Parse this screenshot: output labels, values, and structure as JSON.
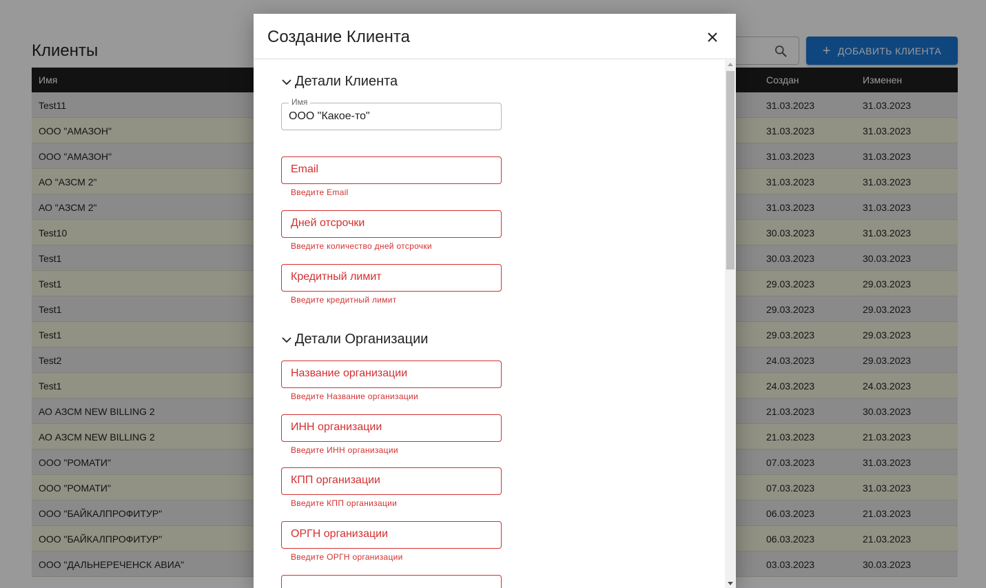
{
  "page": {
    "title": "Клиенты",
    "add_button_label": "ДОБАВИТЬ КЛИЕНТА"
  },
  "table": {
    "headers": {
      "name": "Имя",
      "created": "Создан",
      "updated": "Изменен"
    },
    "rows": [
      {
        "name": "Test11",
        "created": "31.03.2023",
        "updated": "31.03.2023"
      },
      {
        "name": "ООО \"АМАЗОН\"",
        "created": "31.03.2023",
        "updated": "31.03.2023"
      },
      {
        "name": "ООО \"АМАЗОН\"",
        "created": "31.03.2023",
        "updated": "31.03.2023"
      },
      {
        "name": "АО \"АЗСМ 2\"",
        "created": "31.03.2023",
        "updated": "31.03.2023"
      },
      {
        "name": "АО \"АЗСМ 2\"",
        "created": "31.03.2023",
        "updated": "31.03.2023"
      },
      {
        "name": "Test10",
        "created": "30.03.2023",
        "updated": "31.03.2023"
      },
      {
        "name": "Test1",
        "created": "30.03.2023",
        "updated": "30.03.2023"
      },
      {
        "name": "Test1",
        "created": "29.03.2023",
        "updated": "29.03.2023"
      },
      {
        "name": "Test1",
        "created": "29.03.2023",
        "updated": "29.03.2023"
      },
      {
        "name": "Test1",
        "created": "29.03.2023",
        "updated": "29.03.2023"
      },
      {
        "name": "Test2",
        "created": "24.03.2023",
        "updated": "29.03.2023"
      },
      {
        "name": "Test1",
        "created": "24.03.2023",
        "updated": "24.03.2023"
      },
      {
        "name": "АО АЗСМ NEW BILLING 2",
        "created": "21.03.2023",
        "updated": "30.03.2023"
      },
      {
        "name": "АО АЗСМ NEW BILLING 2",
        "created": "21.03.2023",
        "updated": "21.03.2023"
      },
      {
        "name": "ООО \"РОМАТИ\"",
        "created": "07.03.2023",
        "updated": "31.03.2023"
      },
      {
        "name": "ООО \"РОМАТИ\"",
        "created": "07.03.2023",
        "updated": "31.03.2023"
      },
      {
        "name": "ООО \"БАЙКАЛПРОФИТУР\"",
        "created": "06.03.2023",
        "updated": "21.03.2023"
      },
      {
        "name": "ООО \"БАЙКАЛПРОФИТУР\"",
        "created": "06.03.2023",
        "updated": "21.03.2023"
      },
      {
        "name": "ООО \"ДАЛЬНЕРЕЧЕНСК АВИА\"",
        "created": "03.03.2023",
        "updated": "30.03.2023"
      }
    ]
  },
  "modal": {
    "title": "Создание Клиента",
    "section_client": "Детали Клиента",
    "section_org": "Детали Организации",
    "name_field": {
      "label": "Имя",
      "value": "ООО \"Какое-то\""
    },
    "email": {
      "label": "Email",
      "helper": "Введите Email"
    },
    "days": {
      "label": "Дней отсрочки",
      "helper": "Введите количество дней отсрочки"
    },
    "credit": {
      "label": "Кредитный лимит",
      "helper": "Введите кредитный лимит"
    },
    "org_name": {
      "label": "Название организации",
      "helper": "Введите Название организации"
    },
    "org_inn": {
      "label": "ИНН организации",
      "helper": "Введите ИНН организации"
    },
    "org_kpp": {
      "label": "КПП организации",
      "helper": "Введите КПП организации"
    },
    "org_ogrn": {
      "label": "ОРГН организации",
      "helper": "Введите ОРГН организации"
    }
  },
  "colors": {
    "accent": "#1976d2",
    "error": "#d32f2f",
    "header_bg": "#1e1e1e"
  },
  "icons": [
    "search-icon",
    "plus-icon",
    "close-icon",
    "chevron-down-icon"
  ]
}
